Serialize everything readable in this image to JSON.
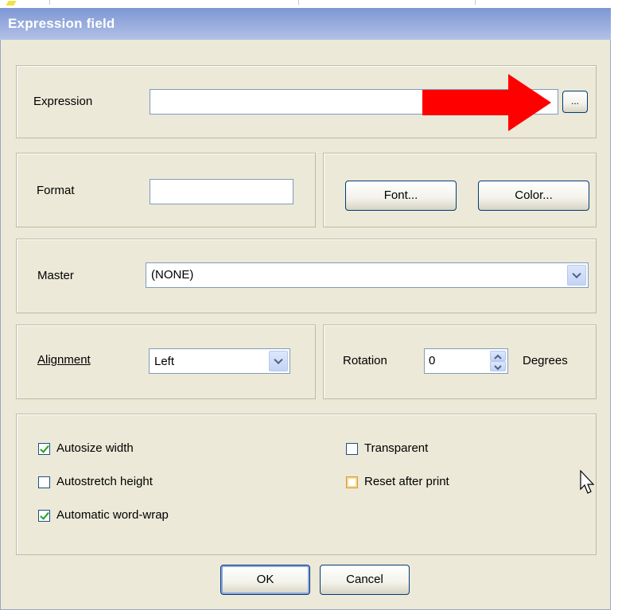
{
  "window": {
    "title": "Expression field"
  },
  "expression": {
    "label": "Expression",
    "value": "",
    "browse_label": "..."
  },
  "format": {
    "label": "Format",
    "value": ""
  },
  "buttons": {
    "font": "Font...",
    "color": "Color...",
    "ok": "OK",
    "cancel": "Cancel"
  },
  "master": {
    "label": "Master",
    "selected": "(NONE)"
  },
  "alignment": {
    "label": "Alignment",
    "selected": "Left"
  },
  "rotation": {
    "label": "Rotation",
    "value": "0",
    "unit": "Degrees"
  },
  "checkboxes": [
    {
      "label": "Autosize width",
      "checked": true
    },
    {
      "label": "Autostretch height",
      "checked": false
    },
    {
      "label": "Automatic word-wrap",
      "checked": true
    },
    {
      "label": "Transparent",
      "checked": false
    },
    {
      "label": "Reset after print",
      "checked": false
    }
  ],
  "annotation": {
    "arrow_color": "#ff0000"
  }
}
